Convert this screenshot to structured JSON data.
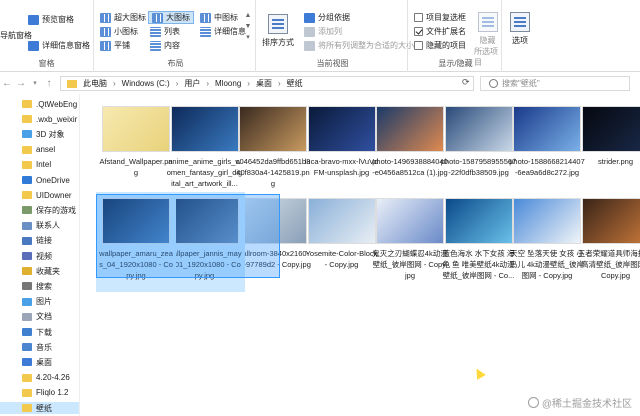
{
  "ribbon": {
    "nav_pane_label": "导航窗格",
    "preview_pane": "预览窗格",
    "details_pane": "详细信息窗格",
    "panes_group": "窗格",
    "layout_items": [
      "超大图标",
      "大图标",
      "中图标",
      "小图标",
      "列表",
      "详细信息",
      "平铺",
      "内容"
    ],
    "layout_selected": "大图标",
    "layout_group": "布局",
    "sort_label": "排序方式",
    "group_by": "分组依据",
    "add_columns": "添加列",
    "fit_columns": "将所有列调整为合适的大小",
    "current_view_group": "当前视图",
    "item_checkboxes": "项目复选框",
    "file_extensions": "文件扩展名",
    "hidden_items": "隐藏的项目",
    "hide_selected_1": "隐藏",
    "hide_selected_2": "所选项目",
    "show_hide_group": "显示/隐藏",
    "options_label": "选项"
  },
  "address": {
    "crumbs": [
      "此电脑",
      "Windows (C:)",
      "用户",
      "Mloong",
      "桌面",
      "壁纸"
    ],
    "search_placeholder": "搜索\"壁纸\""
  },
  "sidebar": {
    "items": [
      {
        "label": ".QtWebEng",
        "icon": "folder-icon",
        "color": "#f2c94c"
      },
      {
        "label": ".wxb_weixir",
        "icon": "folder-icon",
        "color": "#f2c94c"
      },
      {
        "label": "3D 对象",
        "icon": "3d-objects-icon",
        "color": "#4aa0e6"
      },
      {
        "label": "ansel",
        "icon": "folder-icon",
        "color": "#f2c94c"
      },
      {
        "label": "Intel",
        "icon": "folder-icon",
        "color": "#f2c94c"
      },
      {
        "label": "OneDrive",
        "icon": "onedrive-icon",
        "color": "#2f7ad6"
      },
      {
        "label": "UIDowner",
        "icon": "folder-icon",
        "color": "#f2c94c"
      },
      {
        "label": "保存的游戏",
        "icon": "saved-games-icon",
        "color": "#7a9a6a"
      },
      {
        "label": "联系人",
        "icon": "contacts-icon",
        "color": "#6a8fc4"
      },
      {
        "label": "链接",
        "icon": "links-icon",
        "color": "#4a78c0"
      },
      {
        "label": "视频",
        "icon": "videos-icon",
        "color": "#5a6fb8"
      },
      {
        "label": "收藏夹",
        "icon": "favorites-icon",
        "color": "#e0b030"
      },
      {
        "label": "搜索",
        "icon": "search-folder-icon",
        "color": "#777777"
      },
      {
        "label": "图片",
        "icon": "pictures-icon",
        "color": "#4aa0e6"
      },
      {
        "label": "文档",
        "icon": "documents-icon",
        "color": "#9aa6b8"
      },
      {
        "label": "下载",
        "icon": "downloads-icon",
        "color": "#3f7fd0"
      },
      {
        "label": "音乐",
        "icon": "music-icon",
        "color": "#4a86d0"
      },
      {
        "label": "桌面",
        "icon": "desktop-icon",
        "color": "#3d7bd6"
      },
      {
        "label": "4.20-4.26",
        "icon": "folder-icon",
        "color": "#f2c94c"
      },
      {
        "label": "Fliqlo 1.2",
        "icon": "folder-icon",
        "color": "#f2c94c"
      },
      {
        "label": "壁纸",
        "icon": "folder-icon",
        "color": "#f2c94c"
      }
    ],
    "selected": "壁纸"
  },
  "files": [
    {
      "name": "Afstand_Wallpaper.png",
      "thumb": [
        "#f7e9b0",
        "#e8d27a"
      ],
      "selected": false
    },
    {
      "name": "anime_anime_girls_women_fantasy_girl_digital_art_artwork_ill...",
      "thumb": [
        "#0e2a5a",
        "#3a7ac0"
      ],
      "selected": false
    },
    {
      "name": "c046452da9ffbd651b340f830a4-1425819.png",
      "thumb": [
        "#3a2a20",
        "#c89a60"
      ],
      "selected": false
    },
    {
      "name": "luca-bravo-mxx-lVuVdFM-unsplash.jpg",
      "thumb": [
        "#0a1a3a",
        "#3050a0"
      ],
      "selected": false
    },
    {
      "name": "photo-1496938884040-e0456a8512ca (1).jpg",
      "thumb": [
        "#1a3a6a",
        "#e08a50"
      ],
      "selected": false
    },
    {
      "name": "photo-1587958955567-22f0dfb38509.jpg",
      "thumb": [
        "#2a4a7a",
        "#c8d8e8"
      ],
      "selected": false
    },
    {
      "name": "photo-1588668214407-6ea9a6d8c272.jpg",
      "thumb": [
        "#1a3a8a",
        "#7ab0e8"
      ],
      "selected": false
    },
    {
      "name": "strider.png",
      "thumb": [
        "#05080f",
        "#1a2a4a"
      ],
      "selected": false
    },
    {
      "name": "wallpaper_amaru_zeas_04_1920x1080 - Copy.jpg",
      "thumb": [
        "#0a1a3a",
        "#4a7ab0"
      ],
      "selected": true
    },
    {
      "name": "wallpaper_jannis_mayr_01_1920x1080 - Copy.jpg",
      "thumb": [
        "#1a2a4a",
        "#6a8ab0"
      ],
      "selected": true
    },
    {
      "name": "wallroom-3840x2160-bg-97789d2 - Copy.jpg",
      "thumb": [
        "#d8e0e8",
        "#8aa0b8"
      ],
      "selected": false
    },
    {
      "name": "Yosemite-Color-Block - Copy.jpg",
      "thumb": [
        "#8ab0d8",
        "#e8eef4"
      ],
      "selected": false
    },
    {
      "name": "鬼灭之刃蝴蝶忍4k动漫壁纸_彼岸图网 - Copy.jpg",
      "thumb": [
        "#e8eef8",
        "#6a8ac8"
      ],
      "selected": false
    },
    {
      "name": "蓝色海水 水下女孩 海龟 鱼 唯美壁纸4k动漫壁纸_彼岸图网 - Co...",
      "thumb": [
        "#0a4a8a",
        "#6ac0e8"
      ],
      "selected": false
    },
    {
      "name": "天空 坠落天使 女孩 小鸟儿 4k动漫壁纸_彼岸图网 - Copy.jpg",
      "thumb": [
        "#4a8ad8",
        "#f0f4f8"
      ],
      "selected": false
    },
    {
      "name": "王者荣耀道具师海报4k高清壁纸_彼岸图网 - Copy.jpg",
      "thumb": [
        "#3a2418",
        "#c8783a"
      ],
      "selected": false
    }
  ],
  "watermark": "@稀土掘金技术社区"
}
